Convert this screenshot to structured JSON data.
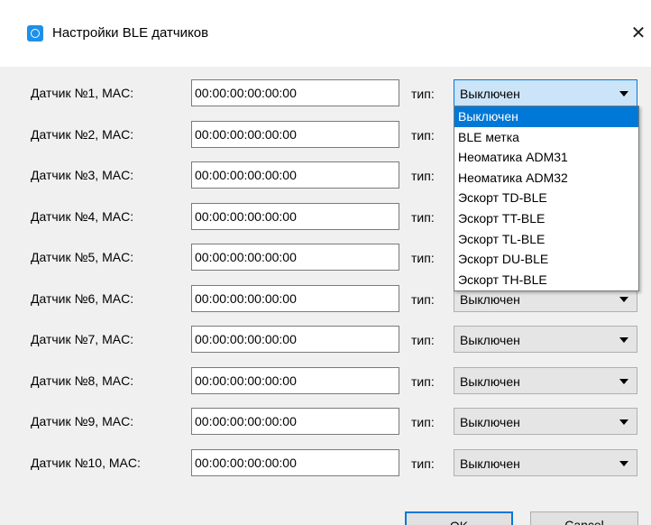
{
  "window": {
    "title": "Настройки BLE датчиков",
    "close_glyph": "✕",
    "app_icon": "ble-settings-icon"
  },
  "form": {
    "type_label": "тип:",
    "rows": [
      {
        "label": "Датчик №1, MAC:",
        "mac": "00:00:00:00:00:00",
        "type": "Выключен"
      },
      {
        "label": "Датчик №2, MAC:",
        "mac": "00:00:00:00:00:00",
        "type": "Выключен"
      },
      {
        "label": "Датчик №3, MAC:",
        "mac": "00:00:00:00:00:00",
        "type": "Выключен"
      },
      {
        "label": "Датчик №4, MAC:",
        "mac": "00:00:00:00:00:00",
        "type": "Выключен"
      },
      {
        "label": "Датчик №5, MAC:",
        "mac": "00:00:00:00:00:00",
        "type": "Выключен"
      },
      {
        "label": "Датчик №6, MAC:",
        "mac": "00:00:00:00:00:00",
        "type": "Выключен"
      },
      {
        "label": "Датчик №7, MAC:",
        "mac": "00:00:00:00:00:00",
        "type": "Выключен"
      },
      {
        "label": "Датчик №8, MAC:",
        "mac": "00:00:00:00:00:00",
        "type": "Выключен"
      },
      {
        "label": "Датчик №9, MAC:",
        "mac": "00:00:00:00:00:00",
        "type": "Выключен"
      },
      {
        "label": "Датчик №10, MAC:",
        "mac": "00:00:00:00:00:00",
        "type": "Выключен"
      }
    ]
  },
  "dropdown": {
    "options": [
      "Выключен",
      "BLE метка",
      "Неоматика ADM31",
      "Неоматика ADM32",
      "Эскорт TD-BLE",
      "Эскорт TT-BLE",
      "Эскорт TL-BLE",
      "Эскорт DU-BLE",
      "Эскорт TH-BLE"
    ],
    "selected_index": 0
  },
  "buttons": {
    "ok": "OK",
    "cancel": "Cancel"
  },
  "colors": {
    "accent": "#0078d7",
    "selected_bg": "#0078d7",
    "open_select_bg": "#cce4f7",
    "dialog_bg": "#f0f0f0"
  }
}
